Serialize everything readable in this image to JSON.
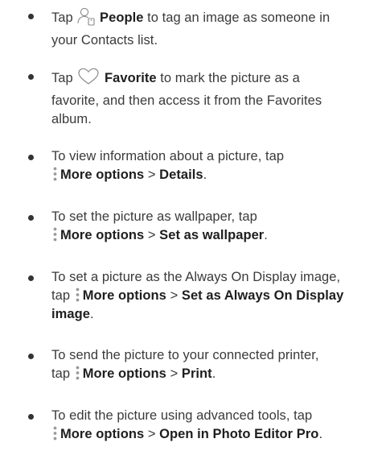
{
  "tips": [
    {
      "lead": "Tap",
      "icon": "person-tag-icon",
      "emphasis": "People",
      "rest_line1": "to tag an image as someone in",
      "rest_line2": "your Contacts list."
    },
    {
      "lead": "Tap",
      "icon": "heart-icon",
      "emphasis": "Favorite",
      "rest_line1": "to mark the picture as a",
      "rest_line2": "favorite, and then access it from the Favorites",
      "rest_line3": "album."
    },
    {
      "line1": "To view information about a picture, tap",
      "icon": "more-options-icon",
      "menu": "More options",
      "separator": ">",
      "item": "Details",
      "end": "."
    },
    {
      "line1": "To set the picture as wallpaper, tap",
      "icon": "more-options-icon",
      "menu": "More options",
      "separator": ">",
      "item": "Set as wallpaper",
      "end": "."
    },
    {
      "line1": "To set a picture as the Always On Display image,",
      "lead2": "tap",
      "icon": "more-options-icon",
      "menu": "More options",
      "separator": ">",
      "item_line1": "Set as Always On Display",
      "item_line2": "image",
      "end": "."
    },
    {
      "line1": "To send the picture to your connected printer,",
      "lead2": "tap",
      "icon": "more-options-icon",
      "menu": "More options",
      "separator": ">",
      "item": "Print",
      "end": "."
    },
    {
      "line1": "To edit the picture using advanced tools, tap",
      "icon": "more-options-icon",
      "menu": "More options",
      "separator": ">",
      "item": "Open in Photo Editor Pro",
      "end": "."
    }
  ]
}
